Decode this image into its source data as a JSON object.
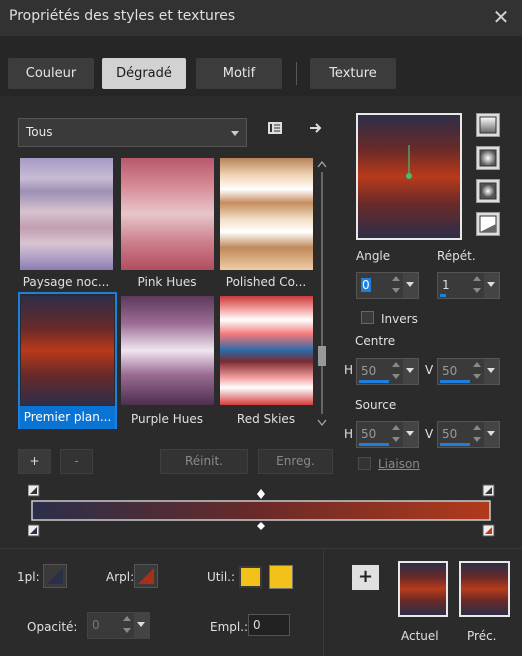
{
  "window": {
    "title": "Propriétés des styles et textures",
    "close_glyph": "✕"
  },
  "tabs": [
    {
      "label": "Couleur"
    },
    {
      "label": "Dégradé"
    },
    {
      "label": "Motif"
    },
    {
      "label": "Texture"
    }
  ],
  "category": {
    "selected": "Tous"
  },
  "gradients": [
    {
      "name": "Paysage noc..."
    },
    {
      "name": "Pink Hues"
    },
    {
      "name": "Polished Co..."
    },
    {
      "name": "Premier plan..."
    },
    {
      "name": "Purple Hues"
    },
    {
      "name": "Red Skies"
    }
  ],
  "buttons": {
    "add": "+",
    "remove": "-",
    "reset": "Réinit.",
    "save": "Enreg."
  },
  "angle": {
    "label": "Angle",
    "value": "0"
  },
  "repeat": {
    "label": "Répét.",
    "value": "1"
  },
  "invert": {
    "label": "Invers"
  },
  "center": {
    "label": "Centre",
    "h_label": "H",
    "h_value": "50",
    "v_label": "V",
    "v_value": "50"
  },
  "source": {
    "label": "Source",
    "h_label": "H",
    "h_value": "50",
    "v_label": "V",
    "v_value": "50"
  },
  "link": {
    "label": "Liaison"
  },
  "bottom": {
    "fg_label": "1pl:",
    "bg_label": "Arpl:",
    "use_label": "Util.:",
    "opacity_label": "Opacité:",
    "opacity_value": "0",
    "location_label": "Empl.:",
    "location_value": "0",
    "current_label": "Actuel",
    "previous_label": "Préc.",
    "add_glyph": "+"
  },
  "colors": {
    "accent": "#1e7fe0",
    "yellow": "#f2c21b",
    "rust": "#a8301a",
    "navy": "#2a2f4a"
  }
}
